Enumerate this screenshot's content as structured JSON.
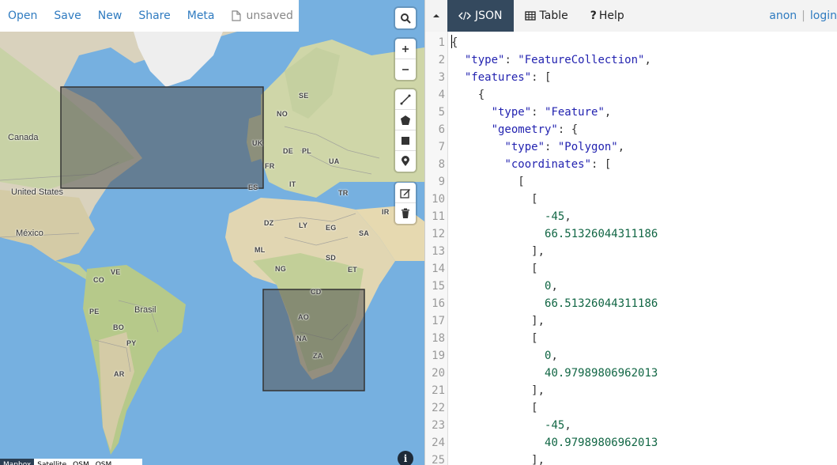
{
  "toolbar": {
    "items": [
      "Open",
      "Save",
      "New",
      "Share",
      "Meta"
    ],
    "file_status": "unsaved"
  },
  "map": {
    "labels": {
      "canada": "Canada",
      "united_states": "United States",
      "mexico": "México",
      "brasil": "Brasil",
      "uk": "UK",
      "fr": "FR",
      "es": "ES",
      "de": "DE",
      "pl": "PL",
      "ua": "UA",
      "it": "IT",
      "tr": "TR",
      "ir": "IR",
      "no": "NO",
      "se": "SE",
      "dz": "DZ",
      "ly": "LY",
      "eg": "EG",
      "sa": "SA",
      "ml": "ML",
      "sd": "SD",
      "ng": "NG",
      "et": "ET",
      "cd": "CD",
      "ao": "AO",
      "na": "NA",
      "za": "ZA",
      "ve": "VE",
      "co": "CO",
      "pe": "PE",
      "bo": "BO",
      "py": "PY",
      "ar": "AR"
    },
    "basemaps": [
      "Mapbox",
      "Satellite",
      "OSM",
      "OSM"
    ],
    "info_label": "i"
  },
  "panel": {
    "tabs": [
      "JSON",
      "Table",
      "Help"
    ],
    "active_tab": "JSON",
    "user": {
      "anon": "anon",
      "separator": "|",
      "login": "login"
    }
  },
  "editor": {
    "lines": [
      "{",
      "  \"type\": \"FeatureCollection\",",
      "  \"features\": [",
      "    {",
      "      \"type\": \"Feature\",",
      "      \"geometry\": {",
      "        \"type\": \"Polygon\",",
      "        \"coordinates\": [",
      "          [",
      "            [",
      "              -45,",
      "              66.51326044311186",
      "            ],",
      "            [",
      "              0,",
      "              66.51326044311186",
      "            ],",
      "            [",
      "              0,",
      "              40.97989806962013",
      "            ],",
      "            [",
      "              -45,",
      "              40.97989806962013",
      "            ],"
    ]
  },
  "colors": {
    "accent": "#2f7bc0",
    "tab_active": "#34495e",
    "sea": "#76b0e0",
    "polygon_fill": "#555555"
  }
}
